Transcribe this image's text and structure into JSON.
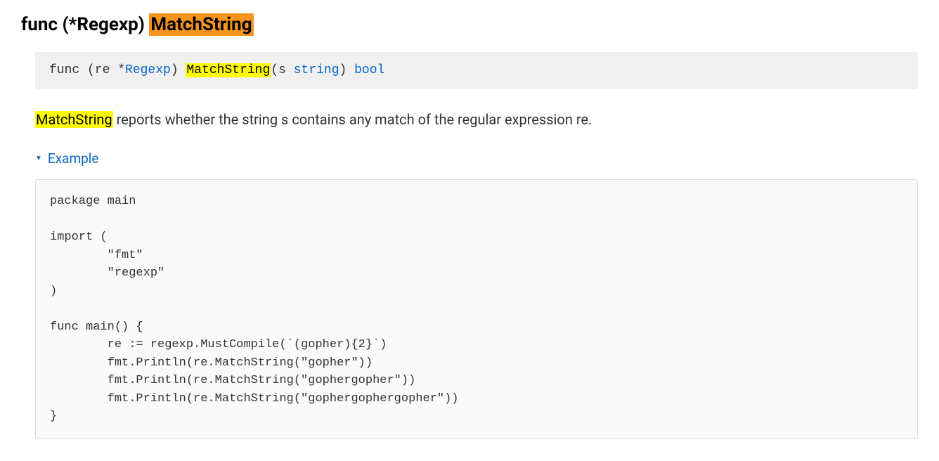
{
  "heading": {
    "prefix": "func (*Regexp) ",
    "highlighted": "MatchString"
  },
  "signature": {
    "func_kw": "func",
    "receiver_open": " (re *",
    "receiver_type": "Regexp",
    "receiver_close": ") ",
    "method_name": "MatchString",
    "params_open": "(s ",
    "param_type": "string",
    "params_close": ") ",
    "return_type": "bool"
  },
  "description": {
    "highlighted": "MatchString",
    "rest": " reports whether the string s contains any match of the regular expression re."
  },
  "example": {
    "label": "Example",
    "code": "package main\n\nimport (\n        \"fmt\"\n        \"regexp\"\n)\n\nfunc main() {\n        re := regexp.MustCompile(`(gopher){2}`)\n        fmt.Println(re.MatchString(\"gopher\"))\n        fmt.Println(re.MatchString(\"gophergopher\"))\n        fmt.Println(re.MatchString(\"gophergophergopher\"))\n}"
  }
}
